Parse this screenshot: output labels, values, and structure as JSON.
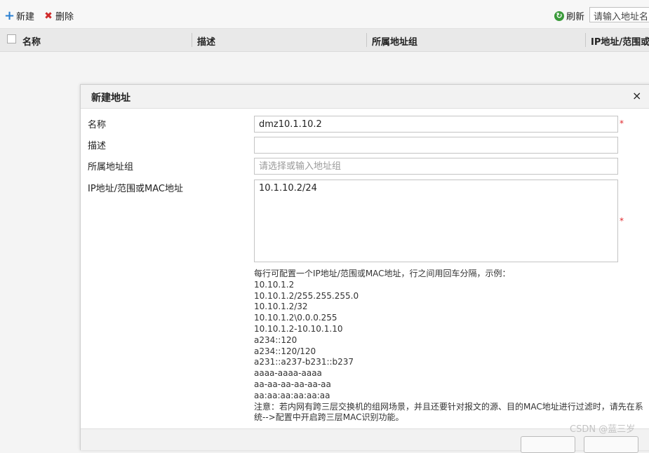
{
  "toolbar": {
    "new_label": "新建",
    "delete_label": "删除",
    "refresh_label": "刷新",
    "search_placeholder": "请输入地址名"
  },
  "table": {
    "columns": [
      "名称",
      "描述",
      "所属地址组",
      "IP地址/范围或"
    ]
  },
  "dialog": {
    "title": "新建地址",
    "close": "×",
    "fields": {
      "name_label": "名称",
      "name_value": "dmz10.1.10.2",
      "desc_label": "描述",
      "desc_value": "",
      "group_label": "所属地址组",
      "group_placeholder": "请选择或输入地址组",
      "ip_label": "IP地址/范围或MAC地址",
      "ip_value": "10.1.10.2/24"
    },
    "required_mark": "*",
    "hint": {
      "intro": "每行可配置一个IP地址/范围或MAC地址，行之间用回车分隔，示例：",
      "examples": [
        "10.10.1.2",
        "10.10.1.2/255.255.255.0",
        "10.10.1.2/32",
        "10.10.1.2\\0.0.0.255",
        "10.10.1.2-10.10.1.10",
        "a234::120",
        "a234::120/120",
        "a231::a237-b231::b237",
        "aaaa-aaaa-aaaa",
        "aa-aa-aa-aa-aa-aa",
        "aa:aa:aa:aa:aa:aa"
      ],
      "note": "注意：若内网有跨三层交换机的组网场景，并且还要针对报文的源、目的MAC地址进行过滤时，请先在系统-->配置中开启跨三层MAC识别功能。"
    }
  },
  "watermark": "CSDN @蓝三岁",
  "colors": {
    "accent_blue": "#2a7fd0",
    "delete_red": "#d02a2a",
    "refresh_green": "#3a9a3a",
    "required_red": "#e0262b"
  }
}
